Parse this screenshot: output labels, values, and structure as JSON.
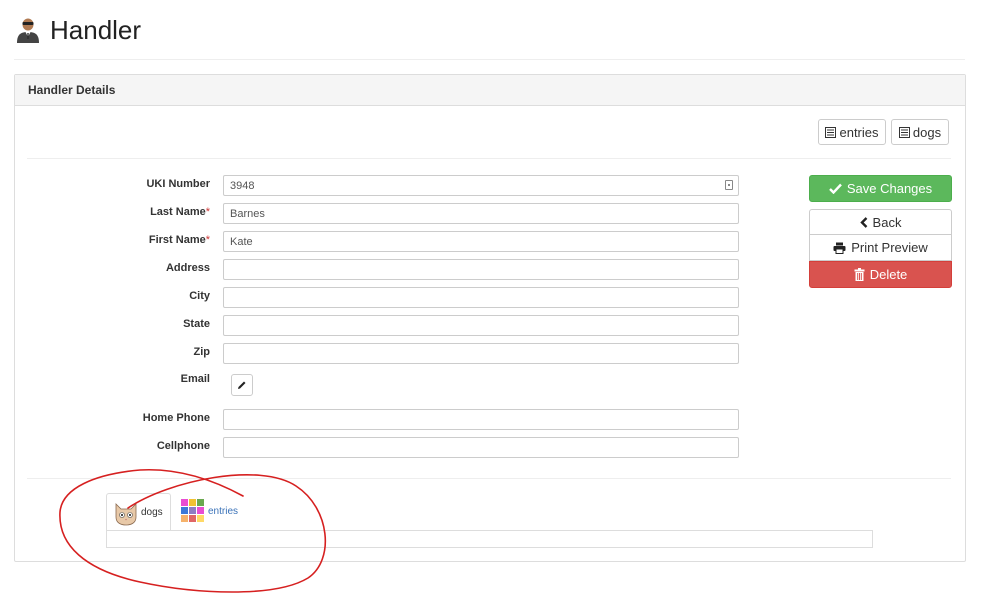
{
  "page": {
    "title": "Handler"
  },
  "panel": {
    "heading": "Handler Details"
  },
  "toolbar": {
    "entries_label": "entries",
    "dogs_label": "dogs"
  },
  "form": {
    "uki_number": {
      "label": "UKI Number",
      "value": "3948"
    },
    "last_name": {
      "label": "Last Name",
      "required_mark": "*",
      "value": "Barnes"
    },
    "first_name": {
      "label": "First Name",
      "required_mark": "*",
      "value": "Kate"
    },
    "address": {
      "label": "Address",
      "value": ""
    },
    "city": {
      "label": "City",
      "value": ""
    },
    "state": {
      "label": "State",
      "value": ""
    },
    "zip": {
      "label": "Zip",
      "value": ""
    },
    "email": {
      "label": "Email"
    },
    "home_phone": {
      "label": "Home Phone",
      "value": ""
    },
    "cellphone": {
      "label": "Cellphone",
      "value": ""
    }
  },
  "actions": {
    "save_label": "Save Changes",
    "back_label": "Back",
    "print_label": "Print Preview",
    "delete_label": "Delete"
  },
  "tabs": [
    {
      "label": "dogs",
      "icon": "cat-face-icon",
      "active": true
    },
    {
      "label": "entries",
      "icon": "color-grid-icon",
      "active": false
    }
  ],
  "colors": {
    "success": "#5cb85c",
    "danger": "#d9534f",
    "link": "#3a72b8",
    "annotation": "#d62020"
  }
}
